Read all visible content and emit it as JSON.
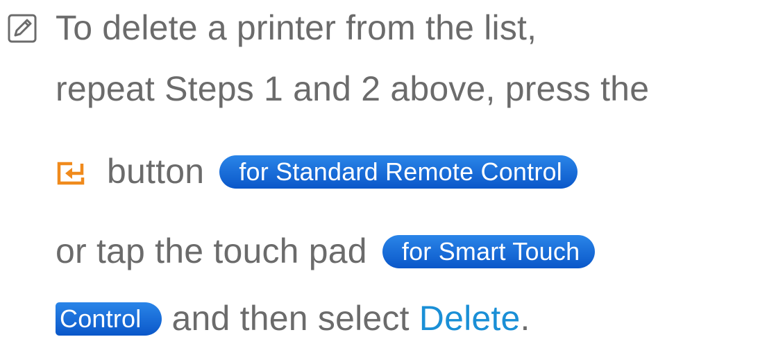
{
  "note": {
    "icon": "note-icon",
    "lines": [
      "To delete a printer from the list,",
      "repeat Steps 1 and 2 above, press the"
    ],
    "line3": {
      "button_icon": "enter-icon",
      "text": "button",
      "badge": "for Standard Remote Control"
    },
    "line4": {
      "text": "or tap the touch pad",
      "badge": "for Smart Touch"
    },
    "line5": {
      "badge": "Control",
      "text": "and then select",
      "highlight": "Delete",
      "end": "."
    }
  },
  "colors": {
    "text": "#6b6b6b",
    "badge_bg": "#0a57c9",
    "badge_text": "#ffffff",
    "highlight": "#1a8fd6",
    "enter_icon": "#f08a1c"
  }
}
